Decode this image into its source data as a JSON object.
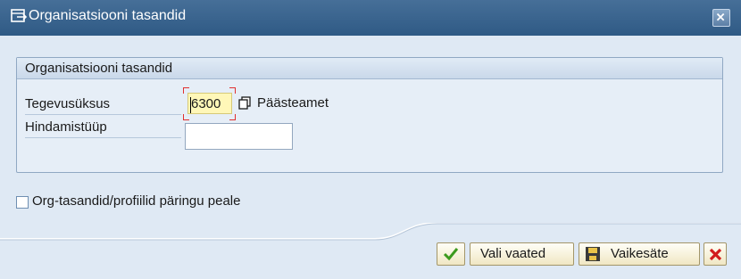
{
  "window": {
    "title": "Organisatsiooni tasandid",
    "title_icon": "exit-dialog-icon",
    "close_icon": "close-icon"
  },
  "group": {
    "title": "Organisatsiooni tasandid",
    "fields": [
      {
        "label": "Tegevusüksus",
        "value": "6300",
        "description": "Päästeamet",
        "value_help_icon": "value-help-icon"
      },
      {
        "label": "Hindamistüüp",
        "value": ""
      }
    ]
  },
  "checkbox": {
    "label": "Org-tasandid/profiilid päringu peale",
    "checked": false
  },
  "toolbar": {
    "continue_icon": "checkmark-icon",
    "select_views_label": "Vali vaated",
    "default_label": "Vaikesäte",
    "default_icon": "save-icon",
    "cancel_icon": "cancel-icon"
  },
  "colors": {
    "title_bar": "#2f5a85",
    "dialog_bg": "#dfe9f4",
    "field_highlight": "#fff7b8",
    "button_bg": "#f0e7c3",
    "confirm_green": "#3b9a1e",
    "cancel_red": "#d21c1c"
  }
}
